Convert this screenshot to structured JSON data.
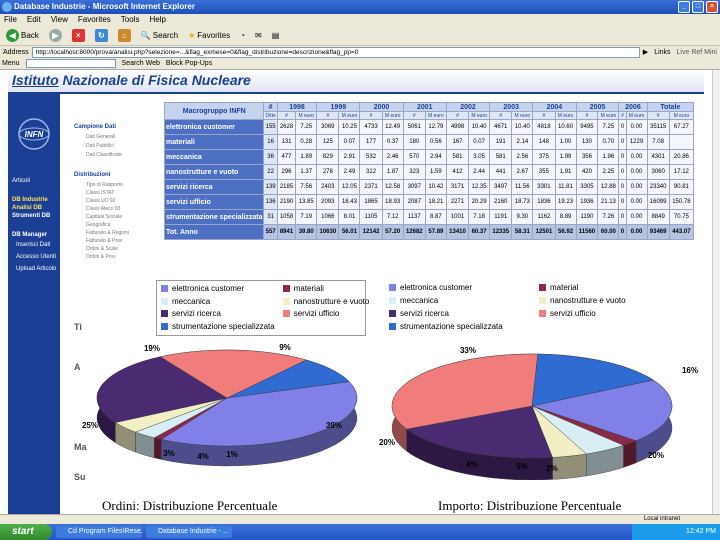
{
  "window": {
    "title": "Database Industrie - Microsoft Internet Explorer"
  },
  "menu": [
    "File",
    "Edit",
    "View",
    "Favorites",
    "Tools",
    "Help"
  ],
  "toolbar": {
    "back": "Back",
    "search": "Search",
    "favorites": "Favorites"
  },
  "address": {
    "label": "Address",
    "value": "http://localhost:8000/prova/analisi.php?selezione=...&flag_exmese=0&flag_distribuzione=descrizione&flag_pp=0"
  },
  "searchbar": {
    "menu": "Menu",
    "search_web": "Search Web",
    "blocked": "Block Pop-Ups",
    "links": "Links",
    "extra": "Web",
    "extra2": "Live Ref Mini"
  },
  "page": {
    "title_part1": "Istituto",
    "title_part2": "Nazionale di Fisica Nucleare",
    "logo_text": "INFN",
    "left_nav": [
      "Articoli",
      "DB Industrie",
      "Analisi DB",
      "Strumenti DB",
      "DB Manager",
      "Inserisci Dati",
      "Accesso Utenti",
      "Upload Articolo"
    ],
    "sub_nav": {
      "heading1": "Campione Dati",
      "items1": [
        "Dati Generali",
        "Dati Pubblici",
        "Dati Classificate"
      ],
      "heading2": "Distribuzioni",
      "items2": [
        "Tipo di Rapporto",
        "Classi ISTAT",
        "Classi UO 92",
        "Classi Ateco 93",
        "Capitale Sociale",
        "Geografica",
        "Fatturato & Regioni",
        "Fatturato & Prov",
        "Ordini & Scale",
        "Ordini & Prov"
      ],
      "side_letters": [
        "Ti",
        "A",
        "Ma",
        "Su"
      ]
    },
    "table": {
      "corner": "Macrogruppo INFN",
      "ditte_header": "# Ditte",
      "years": [
        "1998",
        "1999",
        "2000",
        "2001",
        "2002",
        "2003",
        "2004",
        "2005",
        "2006",
        "Totale"
      ],
      "subheaders": [
        "#",
        "M euro",
        "%"
      ],
      "rows": [
        {
          "label": "elettronica customer",
          "ditte": "155",
          "values": [
            "2628",
            "7.25",
            "3069",
            "10.25",
            "4733",
            "12.49",
            "5061",
            "12.79",
            "4998",
            "10.40",
            "4671",
            "10.40",
            "4818",
            "10.60",
            "9495",
            "7.25",
            "0",
            "0.00",
            "35115",
            "67.27"
          ]
        },
        {
          "label": "materiali",
          "ditte": "16",
          "values": [
            "131",
            "0.28",
            "125",
            "0.07",
            "177",
            "0.37",
            "180",
            "0.56",
            "167",
            "0.07",
            "191",
            "2.14",
            "148",
            "1.00",
            "130",
            "0.70",
            "0",
            "1229",
            "7.08",
            ""
          ]
        },
        {
          "label": "meccanica",
          "ditte": "36",
          "values": [
            "477",
            "1.89",
            "829",
            "2.91",
            "532",
            "2.46",
            "570",
            "2.94",
            "581",
            "3.05",
            "581",
            "2.56",
            "375",
            "1.99",
            "356",
            "1.96",
            "0",
            "0.00",
            "4301",
            "20.86"
          ]
        },
        {
          "label": "nanostrutture e vuoto",
          "ditte": "22",
          "values": [
            "296",
            "1.37",
            "278",
            "2.49",
            "312",
            "1.87",
            "323",
            "1.59",
            "412",
            "2.44",
            "441",
            "2.67",
            "355",
            "1.91",
            "420",
            "2.25",
            "0",
            "0.00",
            "3060",
            "17.12"
          ]
        },
        {
          "label": "servizi ricerca",
          "ditte": "139",
          "values": [
            "2185",
            "7.56",
            "2403",
            "12.05",
            "2371",
            "12.58",
            "3097",
            "10.42",
            "3171",
            "12.35",
            "3497",
            "11.56",
            "3301",
            "11.81",
            "3305",
            "12.88",
            "0",
            "0.00",
            "23340",
            "90.81"
          ]
        },
        {
          "label": "servizi ufficio",
          "ditte": "136",
          "values": [
            "2190",
            "13.85",
            "2093",
            "18.43",
            "1865",
            "18.93",
            "2087",
            "18.21",
            "2271",
            "20.29",
            "2160",
            "18.73",
            "1836",
            "19.23",
            "1936",
            "21.13",
            "0",
            "0.00",
            "16099",
            "150.78"
          ]
        },
        {
          "label": "strumentazione specializzata",
          "ditte": "31",
          "values": [
            "1058",
            "7.19",
            "1066",
            "8.01",
            "1105",
            "7.12",
            "1137",
            "8.87",
            "1001",
            "7.18",
            "1191",
            "9.30",
            "1162",
            "8.89",
            "1190",
            "7.26",
            "0",
            "0.00",
            "8849",
            "70.75"
          ]
        },
        {
          "label": "Tot. Anno",
          "ditte": "557",
          "values": [
            "8941",
            "39.80",
            "10630",
            "56.01",
            "12142",
            "57.20",
            "12682",
            "57.89",
            "13410",
            "60.37",
            "12335",
            "58.31",
            "12501",
            "56.92",
            "11560",
            "60.00",
            "0",
            "0.00",
            "93469",
            "443.07"
          ]
        }
      ]
    },
    "legends": {
      "left": [
        "elettronica customer",
        "materiali",
        "meccanica",
        "nanostrutture e vuoto",
        "servizi ricerca",
        "servizi ufficio",
        "strumentazione specializzata"
      ],
      "right": [
        "elettronica customer",
        "material",
        "meccanica",
        "nanostrutture e vuoto",
        "servizi ricerca",
        "servizi ufficio",
        "strumentazione specializzata"
      ]
    },
    "captions": {
      "left": "Ordini: Distribuzione Percentuale",
      "right": "Importo: Distribuzione Percentuale"
    }
  },
  "colors": {
    "elettronica": "#8080e8",
    "materiali": "#8a2a48",
    "meccanica": "#d8eef4",
    "nanostrutture": "#f2efc4",
    "servizi_ricerca": "#4a2a70",
    "servizi_ufficio": "#f07c7c",
    "strumentazione": "#2f6bd0"
  },
  "chart_data": [
    {
      "type": "pie",
      "title": "Ordini: Distribuzione Percentuale",
      "categories": [
        "elettronica customer",
        "materiali",
        "meccanica",
        "nanostrutture e vuoto",
        "servizi ricerca",
        "servizi ufficio",
        "strumentazione specializzata"
      ],
      "values": [
        39,
        1,
        3,
        4,
        25,
        19,
        9
      ],
      "labels": [
        "39%",
        "1%",
        "3%",
        "4%",
        "25%",
        "19%",
        "9%"
      ]
    },
    {
      "type": "pie",
      "title": "Importo: Distribuzione Percentuale",
      "categories": [
        "elettronica customer",
        "materiali",
        "meccanica",
        "nanostrutture e vuoto",
        "servizi ricerca",
        "servizi ufficio",
        "strumentazione specializzata"
      ],
      "values": [
        20,
        2,
        5,
        4,
        20,
        33,
        16
      ],
      "labels": [
        "20%",
        "2%",
        "5%",
        "4%",
        "20%",
        "33%",
        "16%"
      ]
    }
  ],
  "status": {
    "left": "",
    "right": "Local intranet"
  },
  "taskbar": {
    "start": "start",
    "tasks": [
      "Cd Program Files\\Rese...",
      "Database Industrie - ..."
    ],
    "clock": "12:42 PM"
  }
}
